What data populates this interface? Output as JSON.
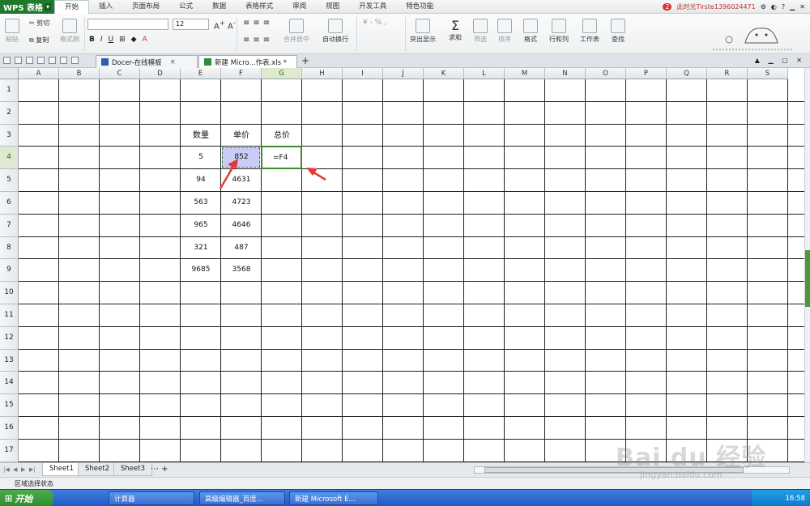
{
  "app": {
    "logo": "WPS 表格"
  },
  "menu": {
    "items": [
      "开始",
      "插入",
      "页面布局",
      "公式",
      "数据",
      "表格样式",
      "审阅",
      "视图",
      "开发工具",
      "特色功能"
    ],
    "user": "此时光Tirste1396024471",
    "badge": "2"
  },
  "ribbon": {
    "paste": "粘贴",
    "cut": "剪切",
    "copy": "复制",
    "format_painter": "格式刷",
    "font_size": "12",
    "merge_center": "合并居中",
    "wrap_text": "自动换行",
    "highlight": "突出显示",
    "sum": "求和",
    "filter": "筛选",
    "sort": "排序",
    "format": "格式",
    "row_col": "行和列",
    "worksheet": "工作表",
    "find": "查找",
    "number_format": "¥ - % ,"
  },
  "tabs": {
    "docer": "Docer-在线模板",
    "file": "新建 Micro...作表.xls *"
  },
  "columns": [
    "A",
    "B",
    "C",
    "D",
    "E",
    "F",
    "G",
    "H",
    "I",
    "J",
    "K",
    "L",
    "M",
    "N",
    "O",
    "P",
    "Q",
    "R",
    "S"
  ],
  "rows": [
    "1",
    "2",
    "3",
    "4",
    "5",
    "6",
    "7",
    "8",
    "9",
    "10",
    "11",
    "12",
    "13",
    "14",
    "15",
    "16",
    "17"
  ],
  "table": {
    "headers": {
      "quantity": "数量",
      "price": "单价",
      "total": "总价"
    },
    "quantity": [
      "5",
      "94",
      "563",
      "965",
      "321",
      "9685"
    ],
    "price": [
      "852",
      "4631",
      "4723",
      "4646",
      "487",
      "3568"
    ],
    "formula": "=F4"
  },
  "sheets": [
    "Sheet1",
    "Sheet2",
    "Sheet3"
  ],
  "status": {
    "mode": "区域选择状态"
  },
  "watermark": {
    "main": "Bai du 经验",
    "sub": "jingyan.baidu.com"
  },
  "taskbar": {
    "start": "开始",
    "tasks": [
      "计算器",
      "高级编辑器_百度...",
      "新建 Microsoft E..."
    ],
    "clock": "16:58"
  },
  "colors": {
    "accent": "#1f7a2c",
    "selection_fill": "#c9cdf6",
    "active_border": "#3d8b2f",
    "arrow": "#e53935"
  }
}
